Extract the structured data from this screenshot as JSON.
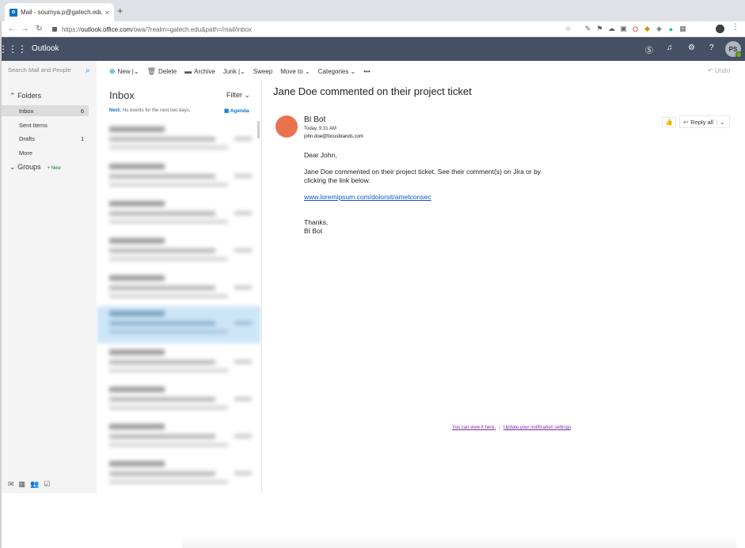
{
  "browser": {
    "tab_title": "Mail - soumya.p@gatech.edu",
    "tab_close": "×",
    "new_tab": "+",
    "url_prefix": "https://",
    "url_host": "outlook.office.com",
    "url_path": "/owa/?realm=gatech.edu&path=/mail/inbox"
  },
  "header": {
    "app_name": "Outlook",
    "user_initials": "PS"
  },
  "leftnav": {
    "search_placeholder": "Search Mail and People",
    "folders_label": "Folders",
    "items": [
      {
        "label": "Inbox",
        "count": "6"
      },
      {
        "label": "Sent Items",
        "count": ""
      },
      {
        "label": "Drafts",
        "count": "1"
      },
      {
        "label": "More",
        "count": ""
      }
    ],
    "groups_label": "Groups",
    "groups_badge": "+ New"
  },
  "toolbar": {
    "new_label": "New",
    "delete_label": "Delete",
    "archive_label": "Archive",
    "junk_label": "Junk",
    "sweep_label": "Sweep",
    "moveto_label": "Move to",
    "categories_label": "Categories",
    "more_label": "•••",
    "undo_label": "Undo"
  },
  "messagelist": {
    "title": "Inbox",
    "filter_label": "Filter",
    "next_label": "Next:",
    "next_text": "No events for the next two days.",
    "agenda_label": "Agenda"
  },
  "message": {
    "subject": "Jane Doe commented on their project ticket",
    "sender_name": "BI Bot",
    "sent_time": "Today, 9:31 AM",
    "sender_email": "john.doe@focusbrands.com",
    "reply_all_label": "Reply all",
    "greeting": "Dear John,",
    "body_line1": "Jane Doe commented on their project ticket. See their comment(s) on Jira or by",
    "body_line2": "clicking the link below.",
    "link": "www.loremipsum.com/dolorsit/ametconsec",
    "signoff": "Thanks,",
    "signature": "BI Bot",
    "footer_view": "You can view it here.",
    "footer_settings": "Update your notification settings"
  },
  "colors": {
    "header_bg": "#465065",
    "accent": "#0078d4",
    "avatar": "#e9734e",
    "selected_row": "#cde6f7"
  }
}
